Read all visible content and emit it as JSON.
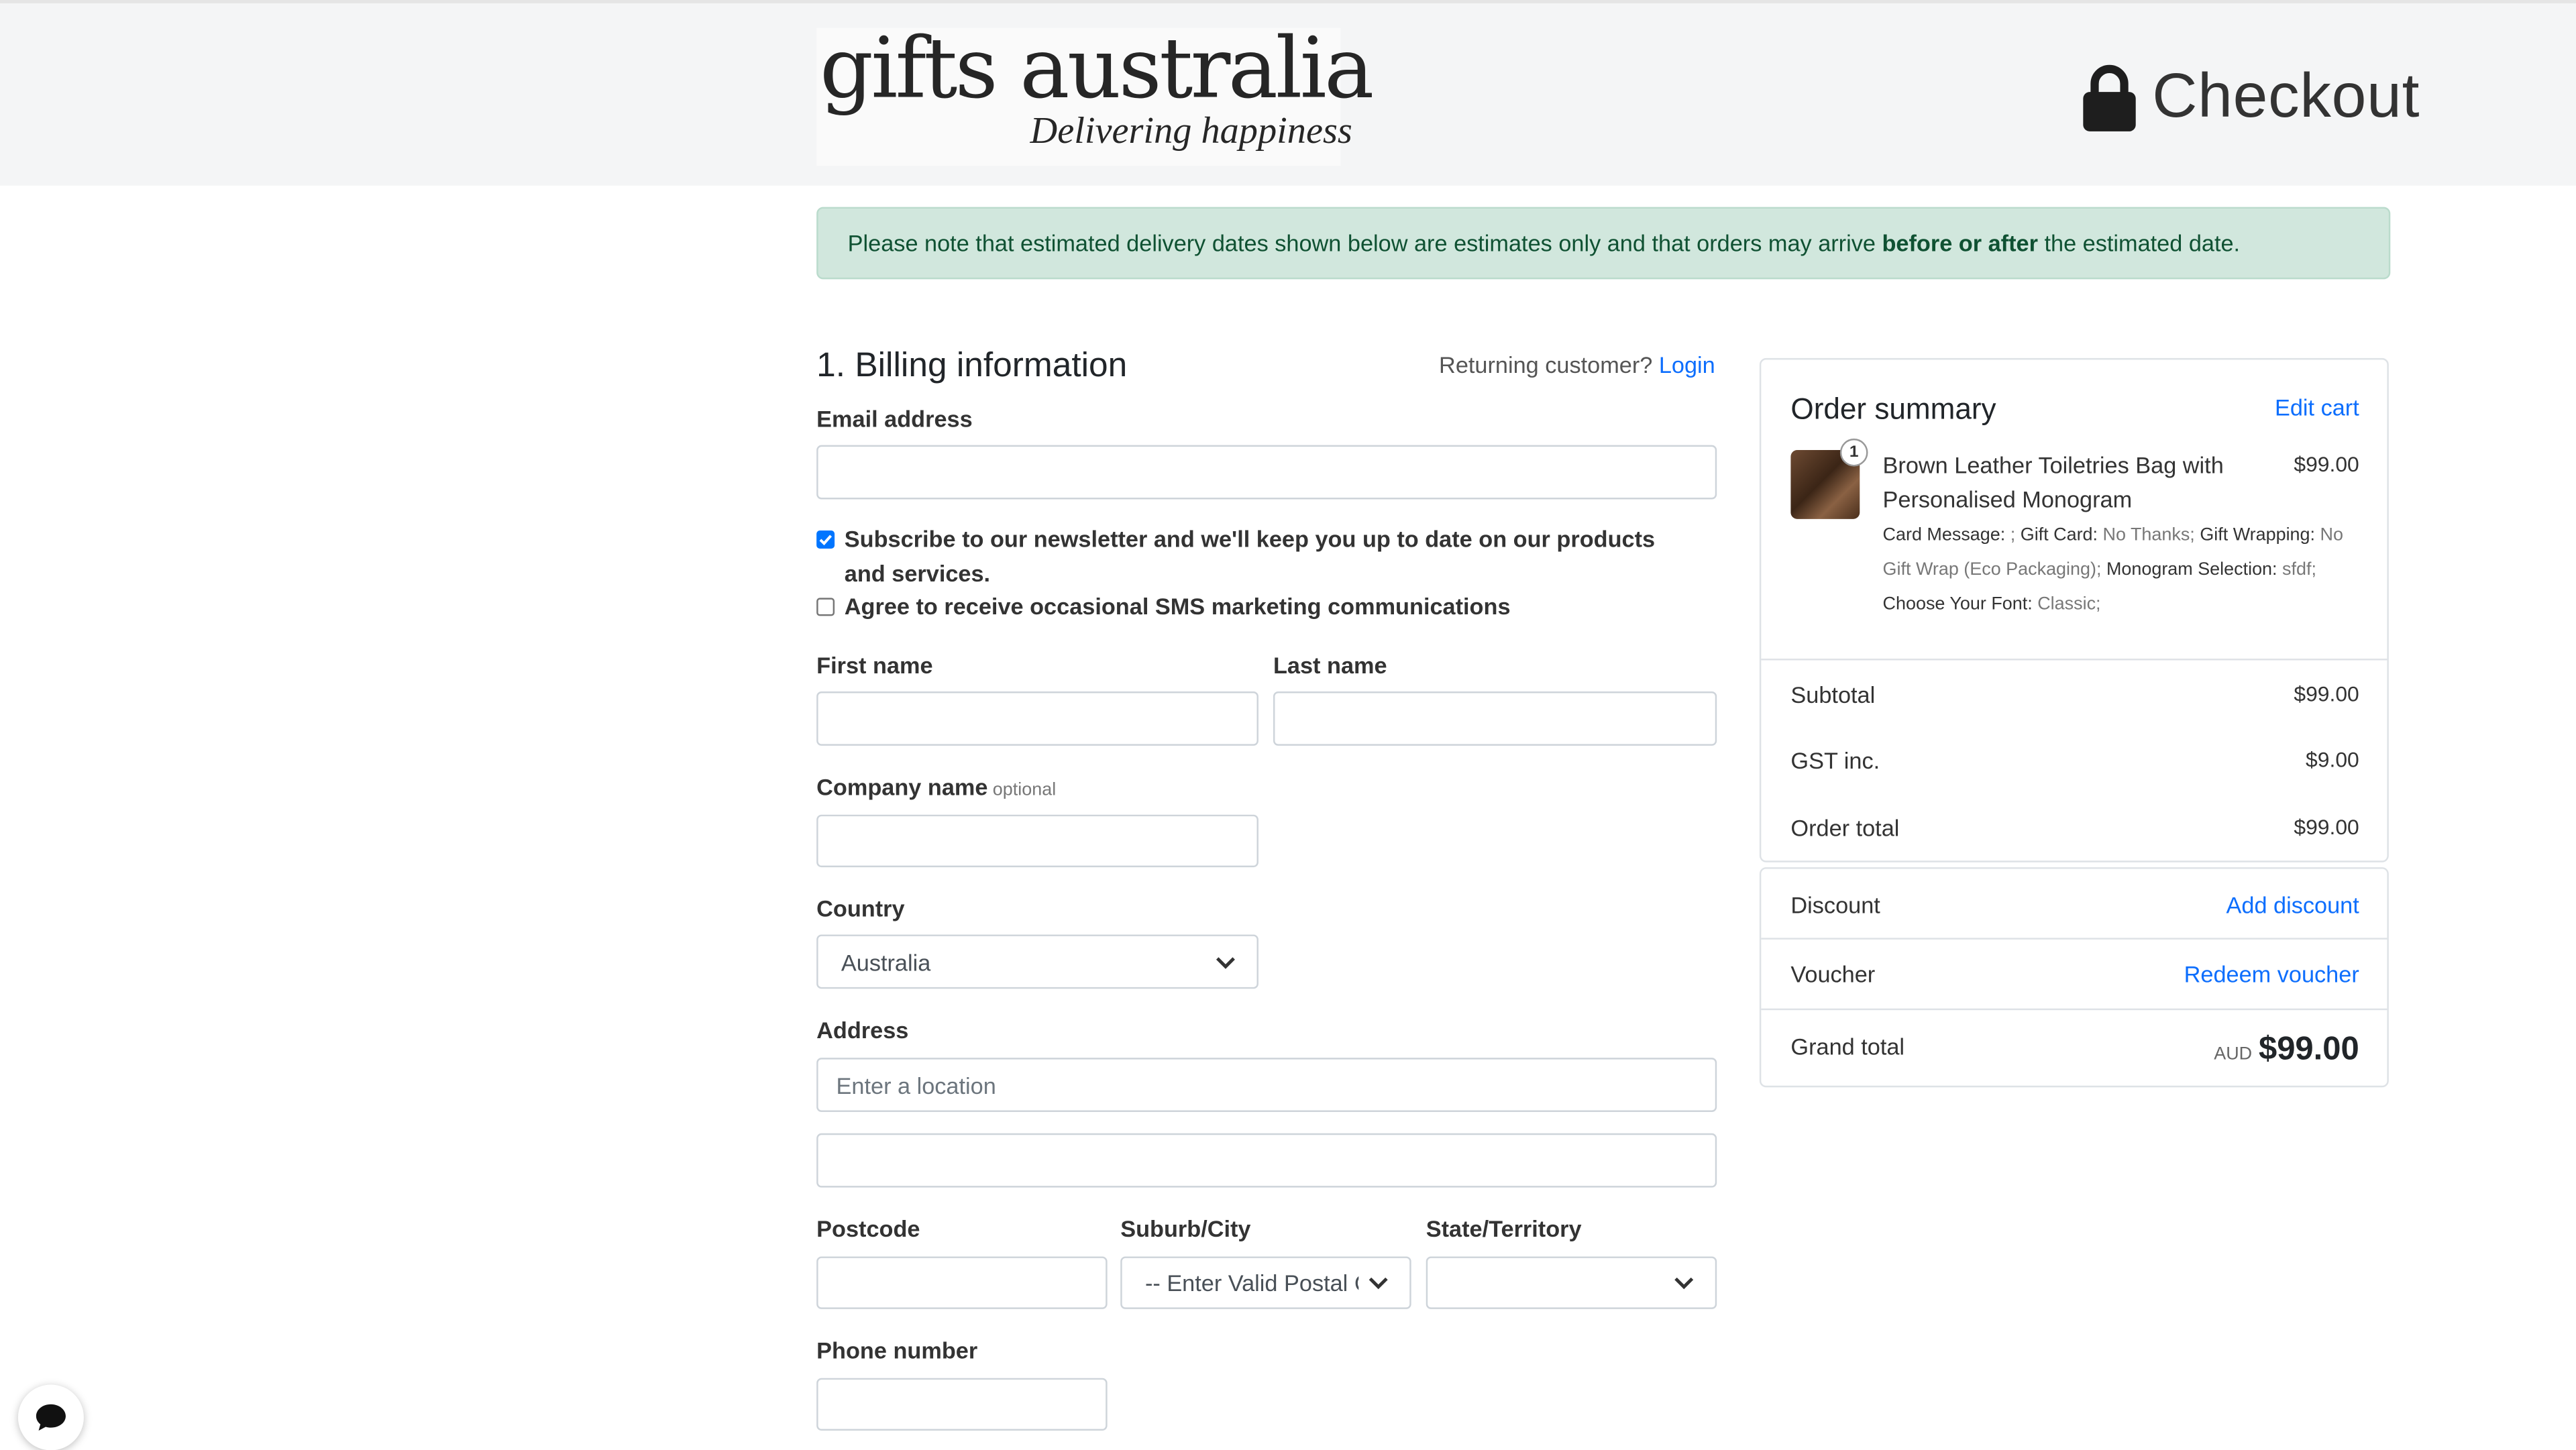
{
  "brand": {
    "logo_word": "gifts australia",
    "logo_tagline": "Delivering happiness"
  },
  "header": {
    "title": "Checkout",
    "icon": "lock-icon"
  },
  "notice": {
    "before": "Please note that estimated delivery dates shown below are estimates only and that orders may arrive ",
    "bold": "before or after",
    "after": " the estimated date."
  },
  "billing": {
    "title": "1. Billing information",
    "returning_text": "Returning customer?",
    "login_link": "Login",
    "email_label": "Email address",
    "email_value": "",
    "newsletter_label": "Subscribe to our newsletter and we'll keep you up to date on our products and services.",
    "newsletter_checked": true,
    "sms_label": "Agree to receive occasional SMS marketing communications",
    "sms_checked": false,
    "first_name_label": "First name",
    "last_name_label": "Last name",
    "company_label": "Company name",
    "company_optional": "optional",
    "country_label": "Country",
    "country_value": "Australia",
    "address_label": "Address",
    "address_placeholder": "Enter a location",
    "postcode_label": "Postcode",
    "suburb_label": "Suburb/City",
    "suburb_value": "-- Enter Valid Postal C",
    "state_label": "State/Territory",
    "state_value": "",
    "phone_label": "Phone number"
  },
  "summary": {
    "title": "Order summary",
    "edit_link": "Edit cart",
    "item": {
      "quantity": "1",
      "name": "Brown Leather Toiletries Bag with Personalised Monogram",
      "price": "$99.00",
      "options": [
        {
          "label": "Card Message:",
          "value": ";"
        },
        {
          "label": "Gift Card:",
          "value": "No Thanks;"
        },
        {
          "label": "Gift Wrapping:",
          "value": "No Gift Wrap (Eco Packaging);"
        },
        {
          "label": "Monogram Selection:",
          "value": "sfdf;"
        },
        {
          "label": "Choose Your Font:",
          "value": "Classic;"
        }
      ]
    },
    "subtotal_label": "Subtotal",
    "subtotal_value": "$99.00",
    "gst_label": "GST inc.",
    "gst_value": "$9.00",
    "order_total_label": "Order total",
    "order_total_value": "$99.00",
    "discount_label": "Discount",
    "discount_link": "Add discount",
    "voucher_label": "Voucher",
    "voucher_link": "Redeem voucher",
    "grand_total_label": "Grand total",
    "currency": "AUD",
    "grand_total_value": "$99.00"
  },
  "chat": {
    "icon": "chat-bubble-icon"
  },
  "colors": {
    "accent": "#0d6efd",
    "notice_bg": "#d1e7dd",
    "notice_text": "#0f5132",
    "header_bg": "#f4f5f6"
  }
}
